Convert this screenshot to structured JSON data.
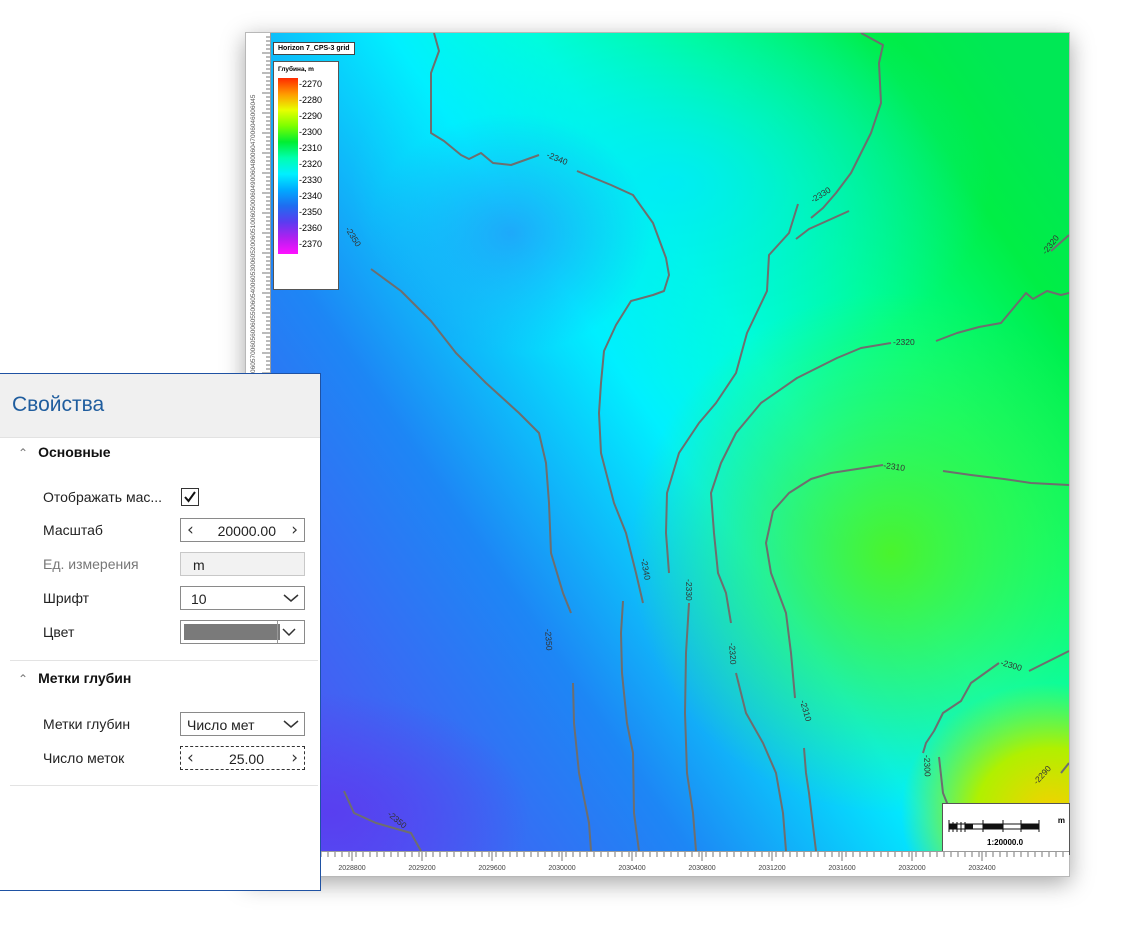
{
  "map": {
    "title": "Horizon 7_CPS-3 grid",
    "legend_title": "Глубина, m",
    "legend_labels": [
      "-2270",
      "-2280",
      "-2290",
      "-2300",
      "-2310",
      "-2320",
      "-2330",
      "-2340",
      "-2350",
      "-2360",
      "-2370"
    ],
    "contour_labels": [
      "-2340",
      "-2350",
      "-2330",
      "-2320",
      "-2320",
      "-2310",
      "-2340",
      "-2330",
      "-2350",
      "-2320",
      "-2310",
      "-2300",
      "-2300",
      "-2290",
      "-2350"
    ],
    "x_ticks": [
      "2028800",
      "2029200",
      "2029600",
      "2030000",
      "2030400",
      "2030800",
      "2031200",
      "2031600",
      "2032000",
      "2032400"
    ],
    "y_ruler_text": "6070006069006068006067006066006065006064006063006062006061006060006059006058006057006056006055006054006053006052006051006050006049006048006047006046006045",
    "scale_unit": "m",
    "scale_text": "1:20000.0",
    "colors": {
      "low": "#5a3cf0",
      "mid": "#00f0ff",
      "high": "#00ee32",
      "contour": "#6e6e6e"
    }
  },
  "panel": {
    "title": "Свойства",
    "section_main": "Основные",
    "show_scale_label": "Отображать мас...",
    "show_scale_checked": true,
    "scale_label": "Масштаб",
    "scale_value": "20000.00",
    "units_label": "Ед. измерения",
    "units_value": "m",
    "font_label": "Шрифт",
    "font_value": "10",
    "color_label": "Цвет",
    "color_value": "#7a7a7a",
    "section_depth": "Метки глубин",
    "depth_marks_label": "Метки глубин",
    "depth_marks_value": "Число мет",
    "marks_count_label": "Число меток",
    "marks_count_value": "25.00"
  }
}
